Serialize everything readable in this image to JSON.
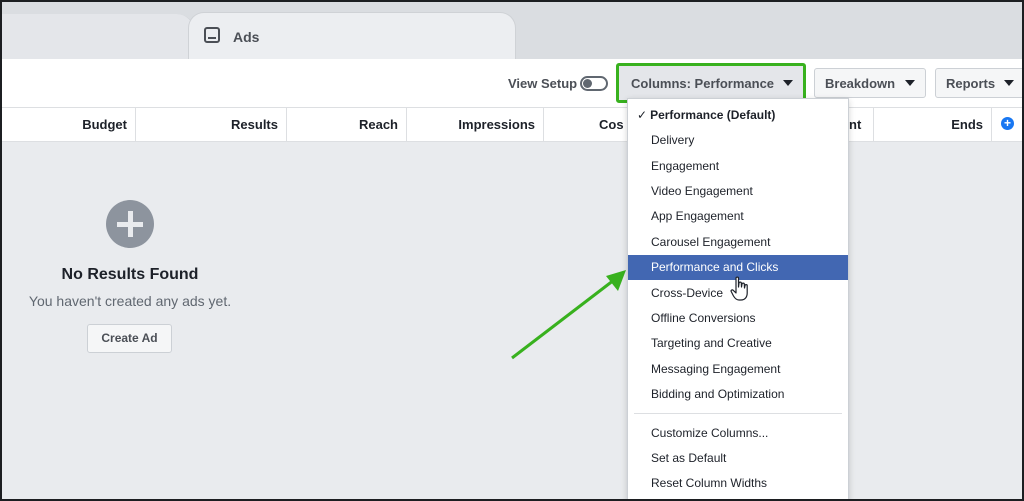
{
  "tabs": {
    "ads_label": "Ads"
  },
  "toolbar": {
    "view_setup_label": "View Setup",
    "columns_label": "Columns: Performance",
    "breakdown_label": "Breakdown",
    "reports_label": "Reports"
  },
  "table": {
    "headers": [
      "Budget",
      "Results",
      "Reach",
      "Impressions",
      "Cos",
      "nt",
      "Ends"
    ]
  },
  "empty_state": {
    "title": "No Results Found",
    "subtitle": "You haven't created any ads yet.",
    "button_label": "Create Ad"
  },
  "columns_menu": {
    "items": [
      "Performance (Default)",
      "Delivery",
      "Engagement",
      "Video Engagement",
      "App Engagement",
      "Carousel Engagement",
      "Performance and Clicks",
      "Cross-Device",
      "Offline Conversions",
      "Targeting and Creative",
      "Messaging Engagement",
      "Bidding and Optimization"
    ],
    "checked_item": "Performance (Default)",
    "highlighted_item": "Performance and Clicks",
    "actions": [
      "Customize Columns...",
      "Set as Default",
      "Reset Column Widths"
    ]
  },
  "colors": {
    "highlight": "#4267b2",
    "annotation_green": "#38b11e",
    "add_column_blue": "#1877f2"
  }
}
